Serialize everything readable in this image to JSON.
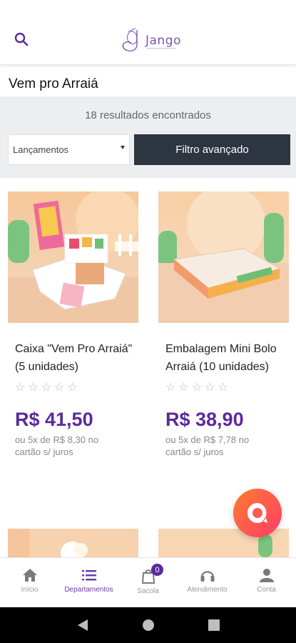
{
  "header": {
    "logo_text": "Jango"
  },
  "page": {
    "title": "Vem pro Arraiá"
  },
  "filters": {
    "results_text": "18 resultados encontrados",
    "sort_value": "Lançamentos",
    "advanced_filter_label": "Filtro avançado"
  },
  "products": [
    {
      "name": "Caixa \"Vem Pro Arraiá\" (5 unidades)",
      "stars": [
        "☆",
        "☆",
        "☆",
        "☆",
        "☆"
      ],
      "price": "R$ 41,50",
      "installment": "ou 5x de R$ 8,30 no cartão s/ juros"
    },
    {
      "name": "Embalagem Mini Bolo Arraiá (10 unidades)",
      "stars": [
        "☆",
        "☆",
        "☆",
        "☆",
        "☆"
      ],
      "price": "R$ 38,90",
      "installment": "ou 5x de R$ 7,78 no cartão s/ juros"
    }
  ],
  "bottom_nav": {
    "items": [
      {
        "label": "Início",
        "icon": "home-icon"
      },
      {
        "label": "Departamentos",
        "icon": "list-icon",
        "active": true
      },
      {
        "label": "Sacola",
        "icon": "bag-icon",
        "badge": "0"
      },
      {
        "label": "Atendimento",
        "icon": "headset-icon"
      },
      {
        "label": "Conta",
        "icon": "user-icon"
      }
    ]
  },
  "colors": {
    "brand_purple": "#5a2a9c",
    "filter_button": "#2c3540",
    "chat_gradient_start": "#ff7b2e",
    "chat_gradient_end": "#ff3d6a"
  }
}
